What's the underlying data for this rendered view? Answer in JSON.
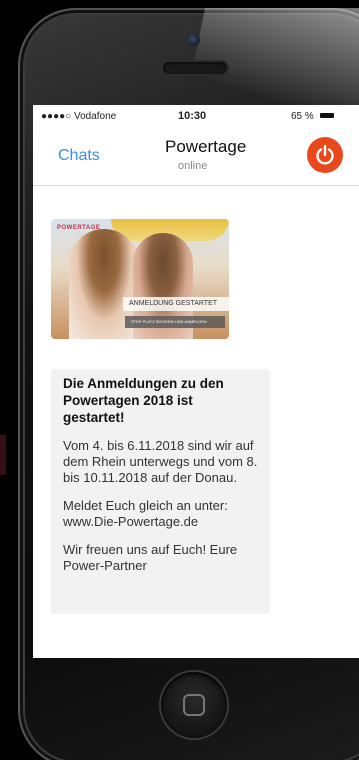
{
  "status_bar": {
    "carrier": "●●●●○ Vodafone",
    "time": "10:30",
    "battery_percent": "65 %"
  },
  "nav": {
    "back_label": "Chats",
    "title": "Powertage",
    "subtitle": "online"
  },
  "image_message": {
    "logo_text": "POWERTAGE",
    "banner_text": "ANMELDUNG GESTARTET",
    "button_text": "STEP PLATZ SICHERN UND ANMELDEN"
  },
  "text_message": {
    "headline": "Die Anmeldungen zu den Powertagen 2018 ist gestartet!",
    "paragraph1": "Vom 4. bis 6.11.2018 sind wir auf dem Rhein unterwegs und vom 8. bis 10.11.2018 auf der Donau.",
    "paragraph2": "Meldet Euch gleich an unter: www.Die-Powertage.de",
    "paragraph3": "Wir freuen uns auf Euch! Eure Power-Partner"
  },
  "colors": {
    "accent_blue": "#3a8fe0",
    "power_orange": "#e8481c",
    "bubble_grey": "#f2f2f2"
  },
  "icons": {
    "power": "power-icon",
    "home": "home-button-icon"
  }
}
